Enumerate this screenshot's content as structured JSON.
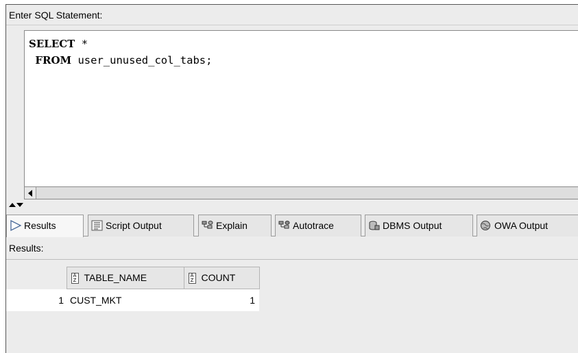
{
  "editor": {
    "label": "Enter SQL Statement:",
    "line1_keyword": "SELECT",
    "line1_rest": " *",
    "line2_keyword": "FROM",
    "line2_rest": " user_unused_col_tabs;"
  },
  "tabs": [
    {
      "label": "Results",
      "icon": "play-icon",
      "active": true
    },
    {
      "label": "Script Output",
      "icon": "script-icon",
      "active": false
    },
    {
      "label": "Explain",
      "icon": "explain-icon",
      "active": false
    },
    {
      "label": "Autotrace",
      "icon": "autotrace-icon",
      "active": false
    },
    {
      "label": "DBMS Output",
      "icon": "dbms-icon",
      "active": false
    },
    {
      "label": "OWA Output",
      "icon": "owa-icon",
      "active": false
    }
  ],
  "results": {
    "label": "Results:",
    "columns": [
      "TABLE_NAME",
      "COUNT"
    ],
    "rows": [
      {
        "num": "1",
        "cells": [
          "CUST_MKT",
          "1"
        ]
      }
    ]
  },
  "colors": {
    "panel_bg": "#ececec",
    "editor_bg": "#ffffff",
    "border": "#8a8a8a"
  }
}
